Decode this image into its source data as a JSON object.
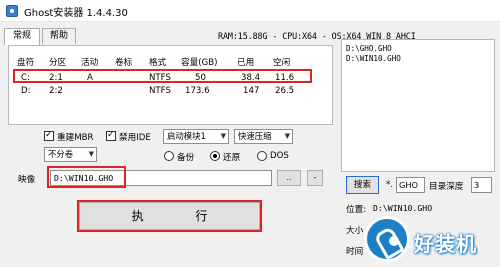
{
  "window": {
    "title": "Ghost安装器 1.4.4.30"
  },
  "tabs": [
    {
      "label": "常规",
      "active": true
    },
    {
      "label": "帮助",
      "active": false
    }
  ],
  "status_line": "RAM:15.88G - CPU:X64 - OS:X64 WIN_8 AHCI",
  "partition_table": {
    "headers": [
      "盘符",
      "分区",
      "活动",
      "卷标",
      "格式",
      "容量(GB)",
      "已用",
      "空闲"
    ],
    "rows": [
      {
        "drive": "C:",
        "partition": "2:1",
        "active": "A",
        "label": "",
        "format": "NTFS",
        "capacity": "50",
        "used": "38.4",
        "free": "11.6",
        "selected": true
      },
      {
        "drive": "D:",
        "partition": "2:2",
        "active": "",
        "label": "",
        "format": "NTFS",
        "capacity": "173.6",
        "used": "147",
        "free": "26.5",
        "selected": false
      }
    ]
  },
  "options": {
    "rebuild_mbr": "重建MBR",
    "disable_ide": "禁用IDE",
    "boot_module": "启动模块1",
    "compression": "快速压缩",
    "split": "不分卷",
    "backup": "备份",
    "restore": "还原",
    "dos": "DOS",
    "selected_mode": "restore"
  },
  "image": {
    "label": "映像",
    "path": "D:\\WIN10.GHO",
    "browse_label": "..",
    "menu_label": "-"
  },
  "run_button": "执 行",
  "file_list": [
    "D:\\GHO.GHO",
    "D:\\WIN10.GHO"
  ],
  "search": {
    "button": "搜索",
    "ext_prefix": "*.",
    "ext_value": "GHO",
    "depth_label": "目录深度",
    "depth_value": "3"
  },
  "location": {
    "label": "位置:",
    "value": "D:\\WIN10.GHO"
  },
  "size_label_partial": "大小",
  "time_label_partial": "时间",
  "watermark": "好装机",
  "colors": {
    "highlight": "#e02424",
    "watermark": "#1e7fc7"
  }
}
